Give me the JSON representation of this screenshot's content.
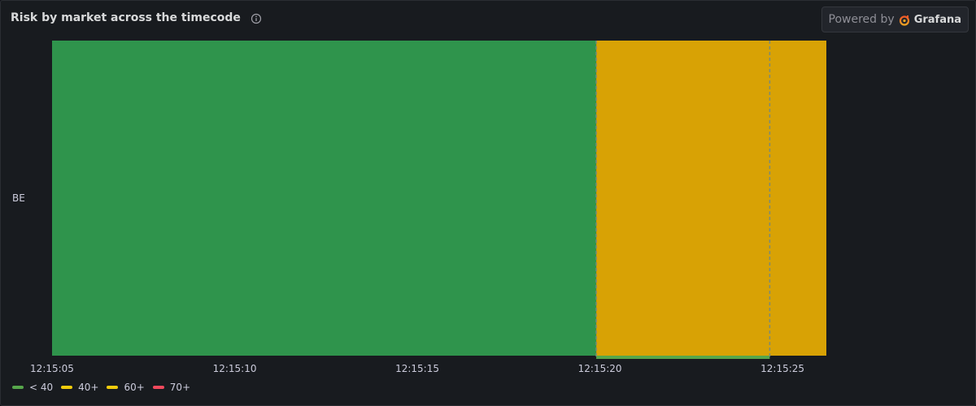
{
  "panel": {
    "title": "Risk by market across the timecode",
    "powered_by_prefix": "Powered by",
    "powered_by_brand": "Grafana"
  },
  "colors": {
    "green": "#2f944c",
    "orange": "#d8a205",
    "legend_green": "#56a64b",
    "legend_yellow": "#f2cc0c",
    "legend_red": "#f2495c"
  },
  "chart_data": {
    "type": "state-timeline",
    "rows": [
      "BE"
    ],
    "x_ticks": [
      "12:15:05",
      "12:15:10",
      "12:15:15",
      "12:15:20",
      "12:15:25"
    ],
    "x_tick_seconds": [
      5,
      10,
      15,
      20,
      25
    ],
    "x_range_seconds": [
      5,
      26.2
    ],
    "segments": [
      {
        "row": "BE",
        "start_seconds": 5,
        "end_seconds": 19.9,
        "state": "< 40",
        "color": "#2f944c"
      },
      {
        "row": "BE",
        "start_seconds": 19.9,
        "end_seconds": 26.2,
        "state": "40+",
        "color": "#d8a205"
      }
    ],
    "dashed_markers_seconds": [
      19.9,
      24.65
    ],
    "highlight_bar": {
      "start_seconds": 19.9,
      "end_seconds": 24.65,
      "color": "#56a64b"
    },
    "legend": [
      {
        "label": "< 40",
        "color": "#56a64b"
      },
      {
        "label": "40+",
        "color": "#f2cc0c"
      },
      {
        "label": "60+",
        "color": "#f2cc0c"
      },
      {
        "label": "70+",
        "color": "#f2495c"
      }
    ]
  }
}
